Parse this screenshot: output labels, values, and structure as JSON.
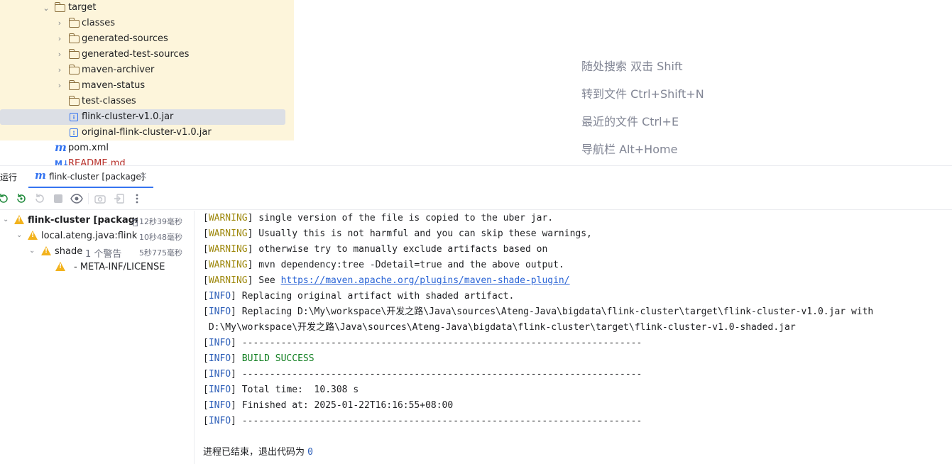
{
  "project_tree": {
    "items": [
      {
        "label": "target",
        "type": "folder",
        "expanded": true
      },
      {
        "label": "classes",
        "type": "folder",
        "expanded": false
      },
      {
        "label": "generated-sources",
        "type": "folder",
        "expanded": false
      },
      {
        "label": "generated-test-sources",
        "type": "folder",
        "expanded": false
      },
      {
        "label": "maven-archiver",
        "type": "folder",
        "expanded": false
      },
      {
        "label": "maven-status",
        "type": "folder",
        "expanded": false
      },
      {
        "label": "test-classes",
        "type": "folder"
      },
      {
        "label": "flink-cluster-v1.0.jar",
        "type": "jar",
        "selected": true
      },
      {
        "label": "original-flink-cluster-v1.0.jar",
        "type": "jar"
      },
      {
        "label": "pom.xml",
        "type": "maven"
      },
      {
        "label": "README.md",
        "type": "markdown"
      }
    ]
  },
  "editor_hints": [
    "随处搜索 双击 Shift",
    "转到文件 Ctrl+Shift+N",
    "最近的文件 Ctrl+E",
    "导航栏 Alt+Home"
  ],
  "run_window": {
    "title": "运行",
    "tab_label": "flink-cluster [package]",
    "close_glyph": "×"
  },
  "run_tree": {
    "items": [
      {
        "name": "flink-cluster [package]:",
        "extra": "在",
        "time": "12秒39毫秒"
      },
      {
        "name": "local.ateng.java:flink-clus",
        "extra": "",
        "time": "10秒48毫秒"
      },
      {
        "name": "shade",
        "extra": "1 个警告",
        "time": "5秒775毫秒"
      },
      {
        "name": "- META-INF/LICENSE",
        "extra": "",
        "time": ""
      }
    ]
  },
  "console": {
    "lines": [
      {
        "level": "WARNING",
        "text": " single version of the file is copied to the uber jar."
      },
      {
        "level": "WARNING",
        "text": " Usually this is not harmful and you can skip these warnings,"
      },
      {
        "level": "WARNING",
        "text": " otherwise try to manually exclude artifacts based on"
      },
      {
        "level": "WARNING",
        "text": " mvn dependency:tree -Ddetail=true and the above output."
      },
      {
        "level": "WARNING",
        "text": " See ",
        "link": "https://maven.apache.org/plugins/maven-shade-plugin/"
      },
      {
        "level": "INFO",
        "text": " Replacing original artifact with shaded artifact."
      },
      {
        "level": "INFO",
        "text": " Replacing D:\\My\\workspace\\开发之路\\Java\\sources\\Ateng-Java\\bigdata\\flink-cluster\\target\\flink-cluster-v1.0.jar with"
      },
      {
        "level": "",
        "text": " D:\\My\\workspace\\开发之路\\Java\\sources\\Ateng-Java\\bigdata\\flink-cluster\\target\\flink-cluster-v1.0-shaded.jar"
      },
      {
        "level": "INFO",
        "text": " ------------------------------------------------------------------------"
      },
      {
        "level": "INFO",
        "text": " ",
        "success": "BUILD SUCCESS"
      },
      {
        "level": "INFO",
        "text": " ------------------------------------------------------------------------"
      },
      {
        "level": "INFO",
        "text": " Total time:  10.308 s"
      },
      {
        "level": "INFO",
        "text": " Finished at: 2025-01-22T16:16:55+08:00"
      },
      {
        "level": "INFO",
        "text": " ------------------------------------------------------------------------"
      }
    ],
    "exit_text": "进程已结束，退出代码为 ",
    "exit_code": "0"
  },
  "colors": {
    "warning": "#9e880d",
    "info": "#2c5eb8",
    "success": "#0f7e1f",
    "link": "#2a64d6",
    "selection": "#dcdfe5",
    "highlight_bg": "#fdf5db"
  }
}
